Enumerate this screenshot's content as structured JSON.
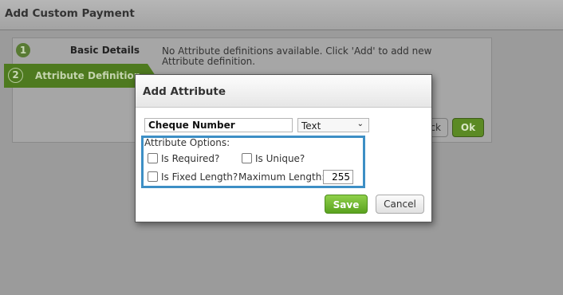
{
  "window": {
    "title": "Add Custom Payment"
  },
  "wizard": {
    "steps": [
      {
        "number": "1",
        "label": "Basic Details"
      },
      {
        "number": "2",
        "label": "Attribute Definition"
      }
    ]
  },
  "main": {
    "empty_message": "No Attribute definitions available. Click 'Add' to add new Attribute definition.",
    "back_label": "ck",
    "ok_label": "Ok"
  },
  "dialog": {
    "title": "Add Attribute",
    "name_value": "Cheque Number",
    "type_value": "Text",
    "options_title": "Attribute Options:",
    "is_required_label": "Is Required?",
    "is_unique_label": "Is Unique?",
    "is_fixed_length_label": "Is Fixed Length?",
    "max_length_label": "Maximum Length:",
    "max_length_value": "255",
    "save_label": "Save",
    "cancel_label": "Cancel"
  },
  "icons": {
    "select_chevron": "chevron-down-icon"
  }
}
